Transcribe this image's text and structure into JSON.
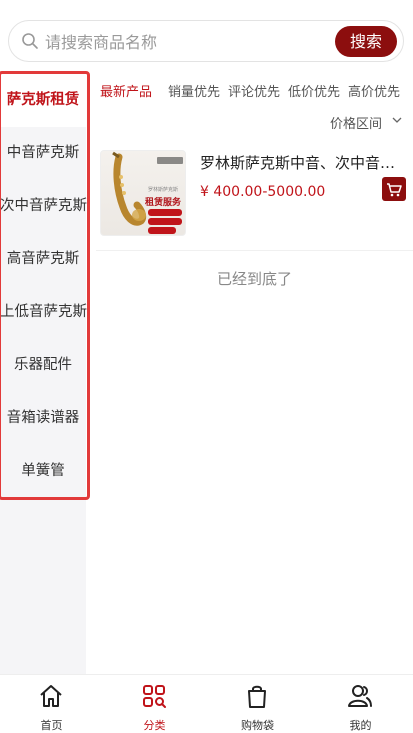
{
  "search": {
    "placeholder": "请搜索商品名称",
    "button_label": "搜索"
  },
  "sidebar": {
    "items": [
      {
        "label": "萨克斯租赁",
        "active": true
      },
      {
        "label": "中音萨克斯",
        "active": false
      },
      {
        "label": "次中音萨克斯",
        "active": false
      },
      {
        "label": "高音萨克斯",
        "active": false
      },
      {
        "label": "上低音萨克斯",
        "active": false
      },
      {
        "label": "乐器配件",
        "active": false
      },
      {
        "label": "音箱读谱器",
        "active": false
      },
      {
        "label": "单簧管",
        "active": false
      }
    ]
  },
  "sort": {
    "tabs": [
      {
        "label": "最新产品",
        "active": true
      },
      {
        "label": "销量优先",
        "active": false
      },
      {
        "label": "评论优先",
        "active": false
      },
      {
        "label": "低价优先",
        "active": false
      },
      {
        "label": "高价优先",
        "active": false
      }
    ],
    "price_range_label": "价格区间"
  },
  "products": [
    {
      "title": "罗林斯萨克斯中音、次中音、高音萨克斯租赁",
      "price": "¥ 400.00-5000.00",
      "image_text": "租赁服务",
      "image_subtext": "罗林斯萨克斯"
    }
  ],
  "list_end_text": "已经到底了",
  "tabbar": {
    "items": [
      {
        "label": "首页",
        "icon": "home-icon",
        "active": false
      },
      {
        "label": "分类",
        "icon": "category-icon",
        "active": true
      },
      {
        "label": "购物袋",
        "icon": "shopping-bag-icon",
        "active": false
      },
      {
        "label": "我的",
        "icon": "profile-icon",
        "active": false
      }
    ]
  },
  "colors": {
    "accent": "#c0141a",
    "button": "#8c0e0e",
    "highlight_frame": "#e23a3a"
  }
}
